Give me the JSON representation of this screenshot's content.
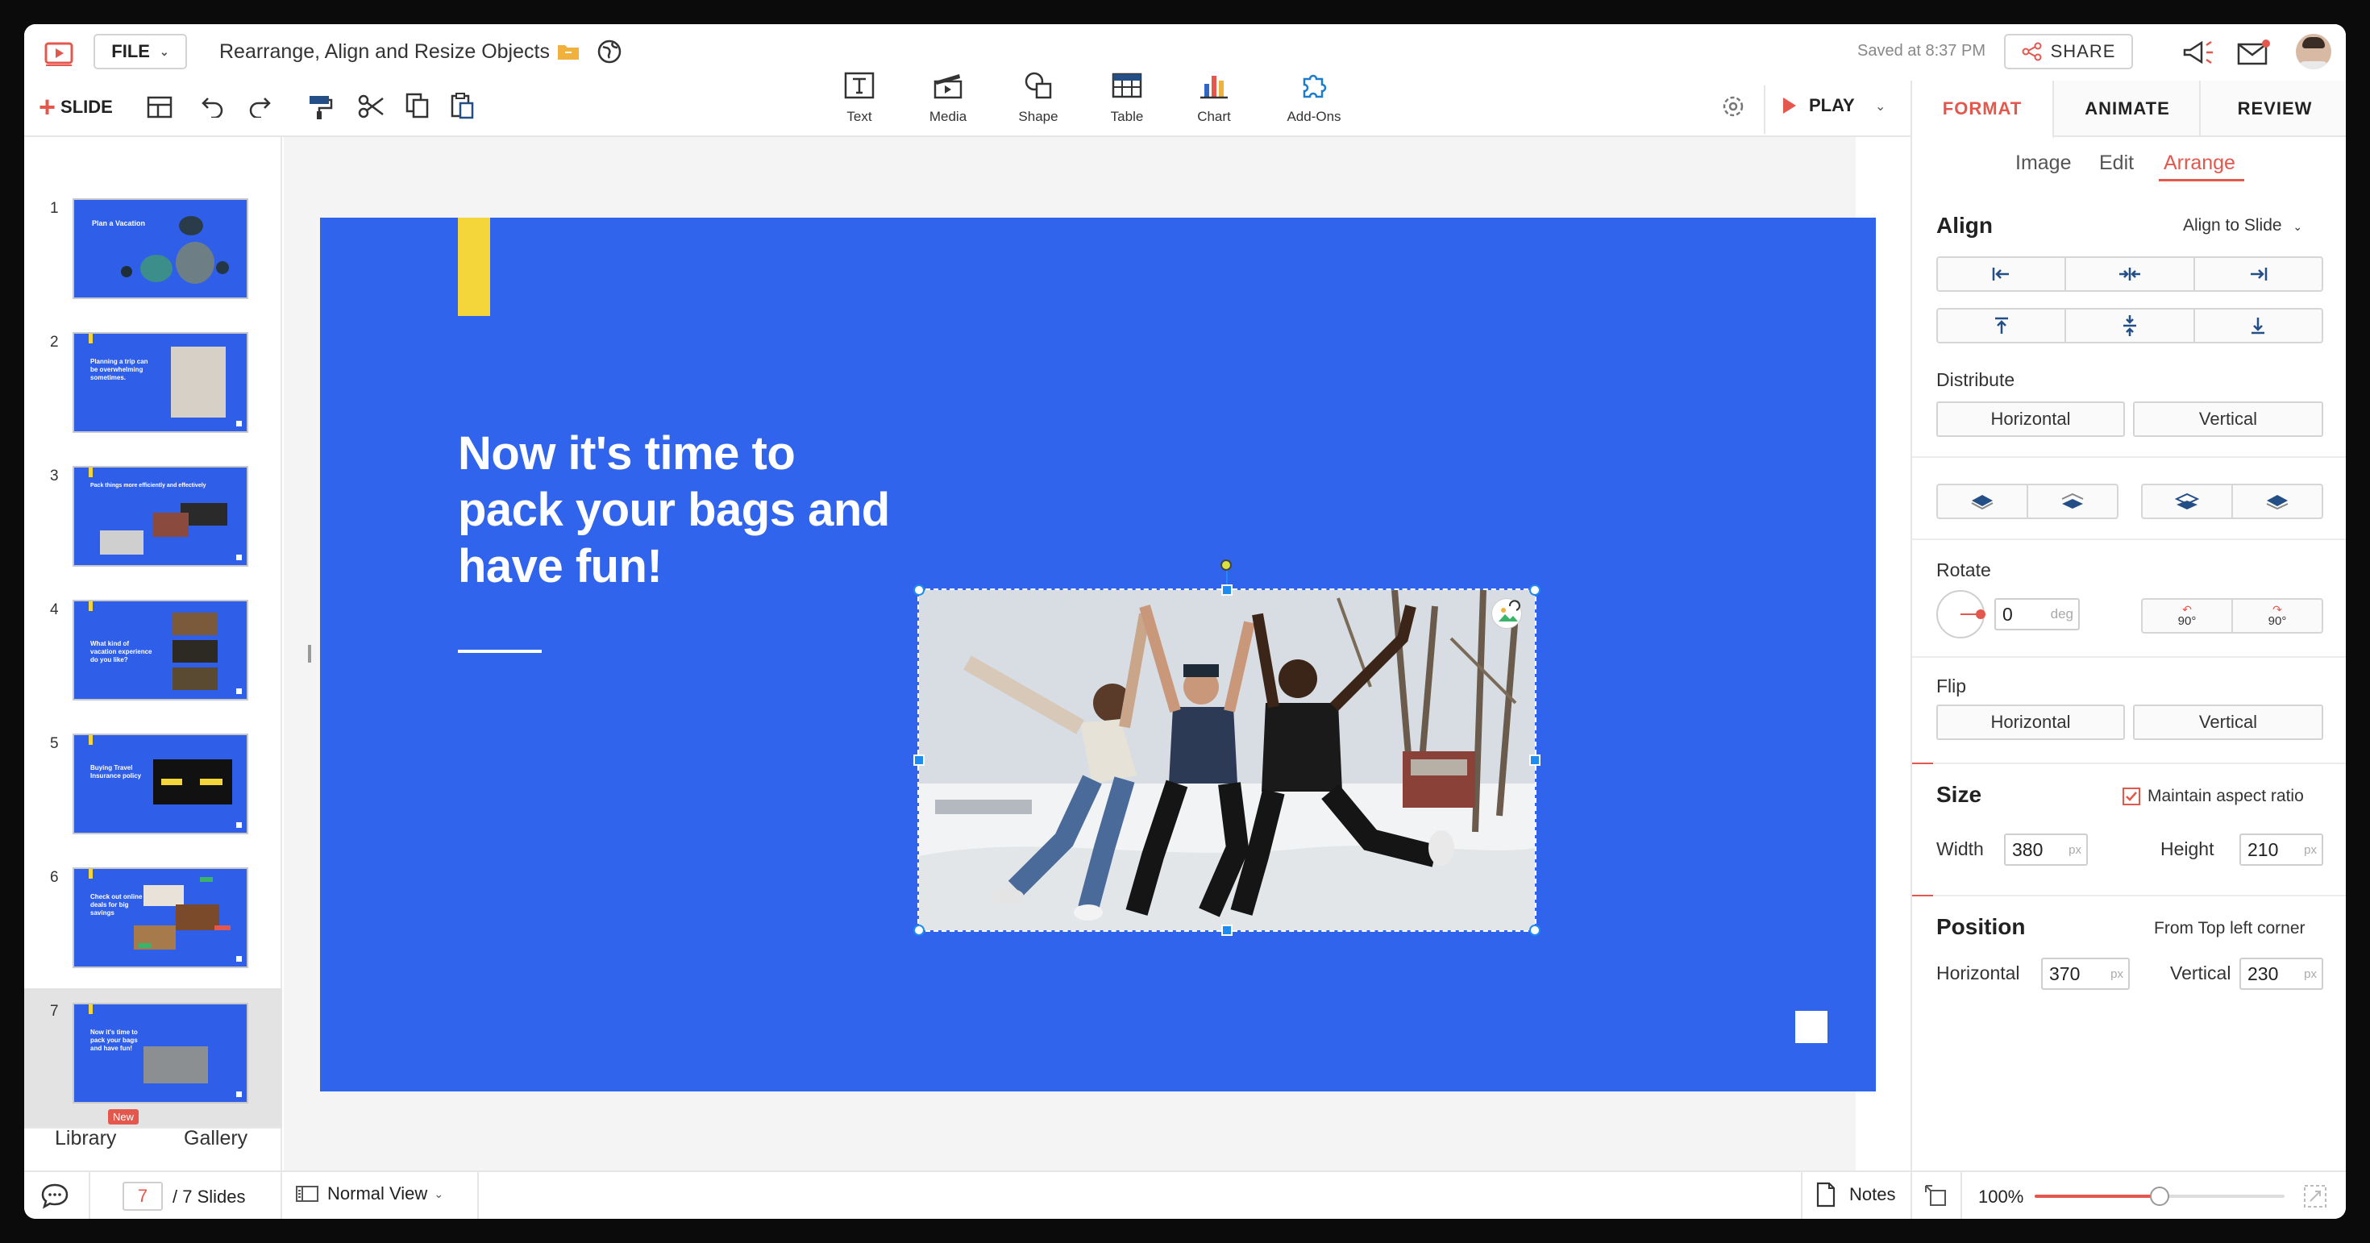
{
  "topbar": {
    "file_label": "FILE",
    "doc_title": "Rearrange, Align and Resize Objects",
    "saved_text": "Saved at 8:37 PM",
    "share_label": "SHARE"
  },
  "toolbar": {
    "slide_label": "SLIDE",
    "insert_tools": [
      {
        "label": "Text",
        "icon": "text-icon"
      },
      {
        "label": "Media",
        "icon": "media-icon"
      },
      {
        "label": "Shape",
        "icon": "shape-icon"
      },
      {
        "label": "Table",
        "icon": "table-icon"
      },
      {
        "label": "Chart",
        "icon": "chart-icon"
      },
      {
        "label": "Add-Ons",
        "icon": "addons-icon"
      }
    ],
    "play_label": "PLAY"
  },
  "slides": [
    {
      "num": "1",
      "title": "Plan a Vacation"
    },
    {
      "num": "2",
      "title": "Planning a trip can be overwhelming sometimes."
    },
    {
      "num": "3",
      "title": "Pack things more efficiently and effectively"
    },
    {
      "num": "4",
      "title": "What kind of vacation experience do you like?"
    },
    {
      "num": "5",
      "title": "Buying Travel Insurance policy"
    },
    {
      "num": "6",
      "title": "Check out online deals for big savings"
    },
    {
      "num": "7",
      "title": "Now it's time to pack your bags and have fun!"
    }
  ],
  "left_tabs": {
    "library": "Library",
    "library_badge": "New",
    "gallery": "Gallery"
  },
  "slide": {
    "heading_line1": "Now it's time to",
    "heading_line2": "pack your bags and",
    "heading_line3": "have fun!"
  },
  "right_panel": {
    "tabs": [
      "FORMAT",
      "ANIMATE",
      "REVIEW"
    ],
    "subtabs": [
      "Image",
      "Edit",
      "Arrange"
    ],
    "align_title": "Align",
    "align_to": "Align to Slide",
    "distribute_title": "Distribute",
    "horizontal": "Horizontal",
    "vertical": "Vertical",
    "rotate_title": "Rotate",
    "rotate_value": "0",
    "rotate_unit": "deg",
    "rotate_ccw": "90°",
    "rotate_cw": "90°",
    "flip_title": "Flip",
    "size_title": "Size",
    "maintain_ratio": "Maintain aspect ratio",
    "width_label": "Width",
    "width_value": "380",
    "height_label": "Height",
    "height_value": "210",
    "unit_px": "px",
    "position_title": "Position",
    "position_from": "From Top left corner",
    "pos_h_label": "Horizontal",
    "pos_h_value": "370",
    "pos_v_label": "Vertical",
    "pos_v_value": "230"
  },
  "status": {
    "current_slide": "7",
    "total_slides": "/ 7 Slides",
    "view_mode": "Normal View",
    "notes_label": "Notes",
    "zoom": "100%",
    "zoom_fraction": 0.5
  },
  "colors": {
    "accent": "#e4574c",
    "slide_bg": "#3064ec",
    "yellow": "#f4d53a",
    "selection": "#1e8bf0"
  }
}
